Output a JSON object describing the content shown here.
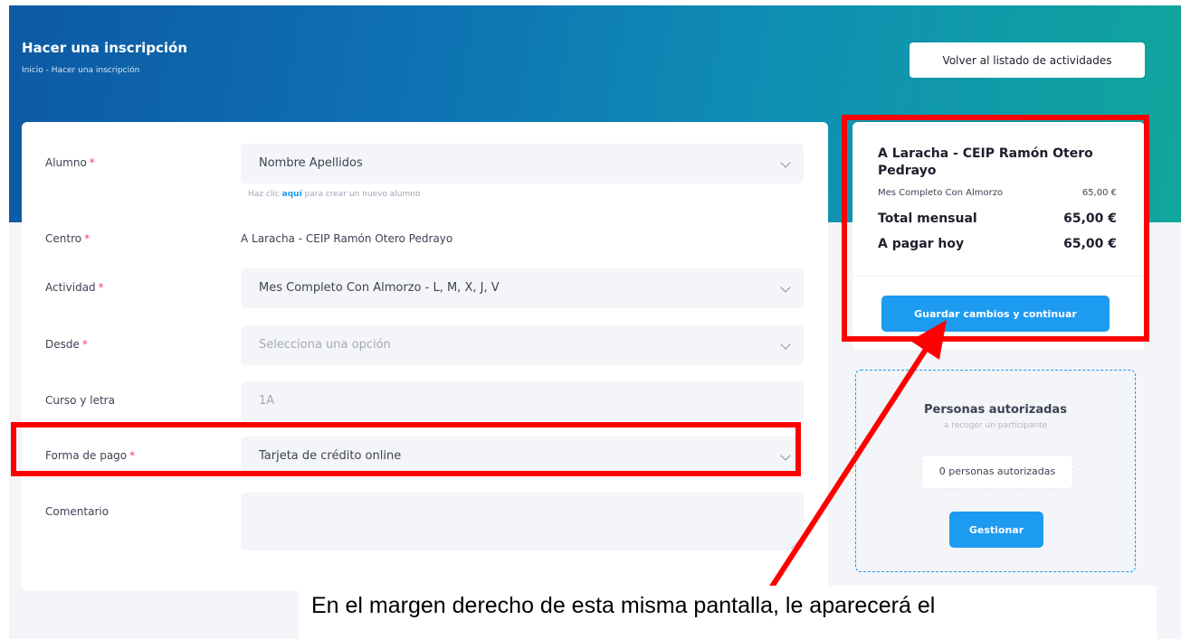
{
  "header": {
    "title": "Hacer una inscripción",
    "breadcrumb": "Inicio - Hacer una inscripción",
    "back_button": "Volver al listado de actividades"
  },
  "form": {
    "alumno": {
      "label": "Alumno",
      "value": "Nombre Apellidos",
      "hint_before": "Haz clic ",
      "hint_link": "aquí",
      "hint_after": " para crear un nuevo alumno"
    },
    "centro": {
      "label": "Centro",
      "value": "A Laracha - CEIP Ramón Otero Pedrayo"
    },
    "actividad": {
      "label": "Actividad",
      "value": "Mes Completo Con Almorzo - L, M, X, J, V"
    },
    "desde": {
      "label": "Desde",
      "placeholder": "Selecciona una opción"
    },
    "curso": {
      "label": "Curso y letra",
      "value": "1A"
    },
    "pago": {
      "label": "Forma de pago",
      "value": "Tarjeta de crédito online"
    },
    "comentario": {
      "label": "Comentario",
      "value": ""
    },
    "required_mark": "*"
  },
  "summary": {
    "center": "A Laracha - CEIP Ramón Otero Pedrayo",
    "item_label": "Mes Completo Con Almorzo",
    "item_price": "65,00 €",
    "total_label": "Total mensual",
    "total_value": "65,00 €",
    "today_label": "A pagar hoy",
    "today_value": "65,00 €",
    "save_button": "Guardar cambios y continuar"
  },
  "authorized": {
    "title": "Personas autorizadas",
    "subtitle": "a recoger un participante",
    "count": "0 personas autorizadas",
    "manage_button": "Gestionar"
  },
  "annotation": {
    "caption": "En el margen derecho de esta misma pantalla, le aparecerá el",
    "highlight_color": "#ff0000"
  },
  "colors": {
    "accent": "#1d9bf0",
    "required": "#f1416c"
  }
}
